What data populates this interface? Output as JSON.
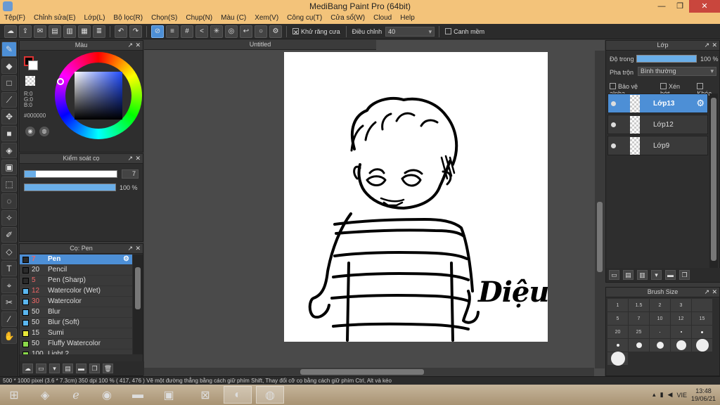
{
  "title": "MediBang Paint Pro (64bit)",
  "window_buttons": {
    "min": "—",
    "max": "❐",
    "close": "✕"
  },
  "menu": [
    "Tệp(F)",
    "Chỉnh sửa(E)",
    "Lớp(L)",
    "Bộ lọc(R)",
    "Chọn(S)",
    "Chụp(N)",
    "Màu (C)",
    "Xem(V)",
    "Công cụ(T)",
    "Cửa sổ(W)",
    "Cloud",
    "Help"
  ],
  "toolbar": {
    "antialias_label": "Khử răng cưa",
    "adjust_label": "Điều chỉnh",
    "adjust_value": "40",
    "edge_label": "Canh mềm"
  },
  "color_panel": {
    "title": "Màu",
    "r": "R:0",
    "g": "G:0",
    "b": "B:0",
    "hex": "#000000"
  },
  "brush_control": {
    "title": "Kiểm soát cọ",
    "size_value": "7",
    "opacity_value": "100 %",
    "size_fraction": 0.12,
    "opacity_fraction": 1.0
  },
  "pen_panel": {
    "title": "Cọ: Pen",
    "items": [
      {
        "size": "7",
        "name": "Pen",
        "color": "#2a2a2a",
        "selected": true
      },
      {
        "size": "20",
        "name": "Pencil",
        "color": "#2a2a2a"
      },
      {
        "size": "5",
        "name": "Pen (Sharp)",
        "color": "#2a2a2a"
      },
      {
        "size": "12",
        "name": "Watercolor (Wet)",
        "color": "#5bb7f0"
      },
      {
        "size": "30",
        "name": "Watercolor",
        "color": "#5bb7f0"
      },
      {
        "size": "50",
        "name": "Blur",
        "color": "#5bb7f0"
      },
      {
        "size": "50",
        "name": "Blur (Soft)",
        "color": "#5bb7f0"
      },
      {
        "size": "15",
        "name": "Sumi",
        "color": "#e8e83a"
      },
      {
        "size": "50",
        "name": "Fluffy Watercolor",
        "color": "#8bd84a"
      },
      {
        "size": "100",
        "name": "Light 2",
        "color": "#8bd84a"
      }
    ]
  },
  "canvas": {
    "tab_title": "Untitled",
    "signature": "Diệu"
  },
  "layer_panel": {
    "title": "Lớp",
    "opacity_label": "Độ trong",
    "opacity_value": "100 %",
    "blend_label": "Pha trộn",
    "blend_value": "Bình thường",
    "protect_alpha": "Bảo vệ alpha",
    "clip": "Xén bớt",
    "lock": "Khóa",
    "layers": [
      {
        "name": "Lớp13",
        "selected": true
      },
      {
        "name": "Lớp12"
      },
      {
        "name": "Lớp9"
      }
    ]
  },
  "brush_size": {
    "title": "Brush Size",
    "sizes": [
      "1",
      "1.5",
      "2",
      "3",
      "",
      "5",
      "7",
      "10",
      "12",
      "15",
      "20",
      "25"
    ]
  },
  "status": "500 * 1000 pixel  (3.6 * 7.3cm)  350 dpi  100 %  ( 417, 476 )  Vẽ một đường thẳng bằng cách giữ phím Shift, Thay đổi cỡ cọ bằng cách giữ phím Ctrl, Alt và kéo",
  "taskbar": {
    "lang": "VIE",
    "time": "13:48",
    "date": "19/06/21"
  }
}
